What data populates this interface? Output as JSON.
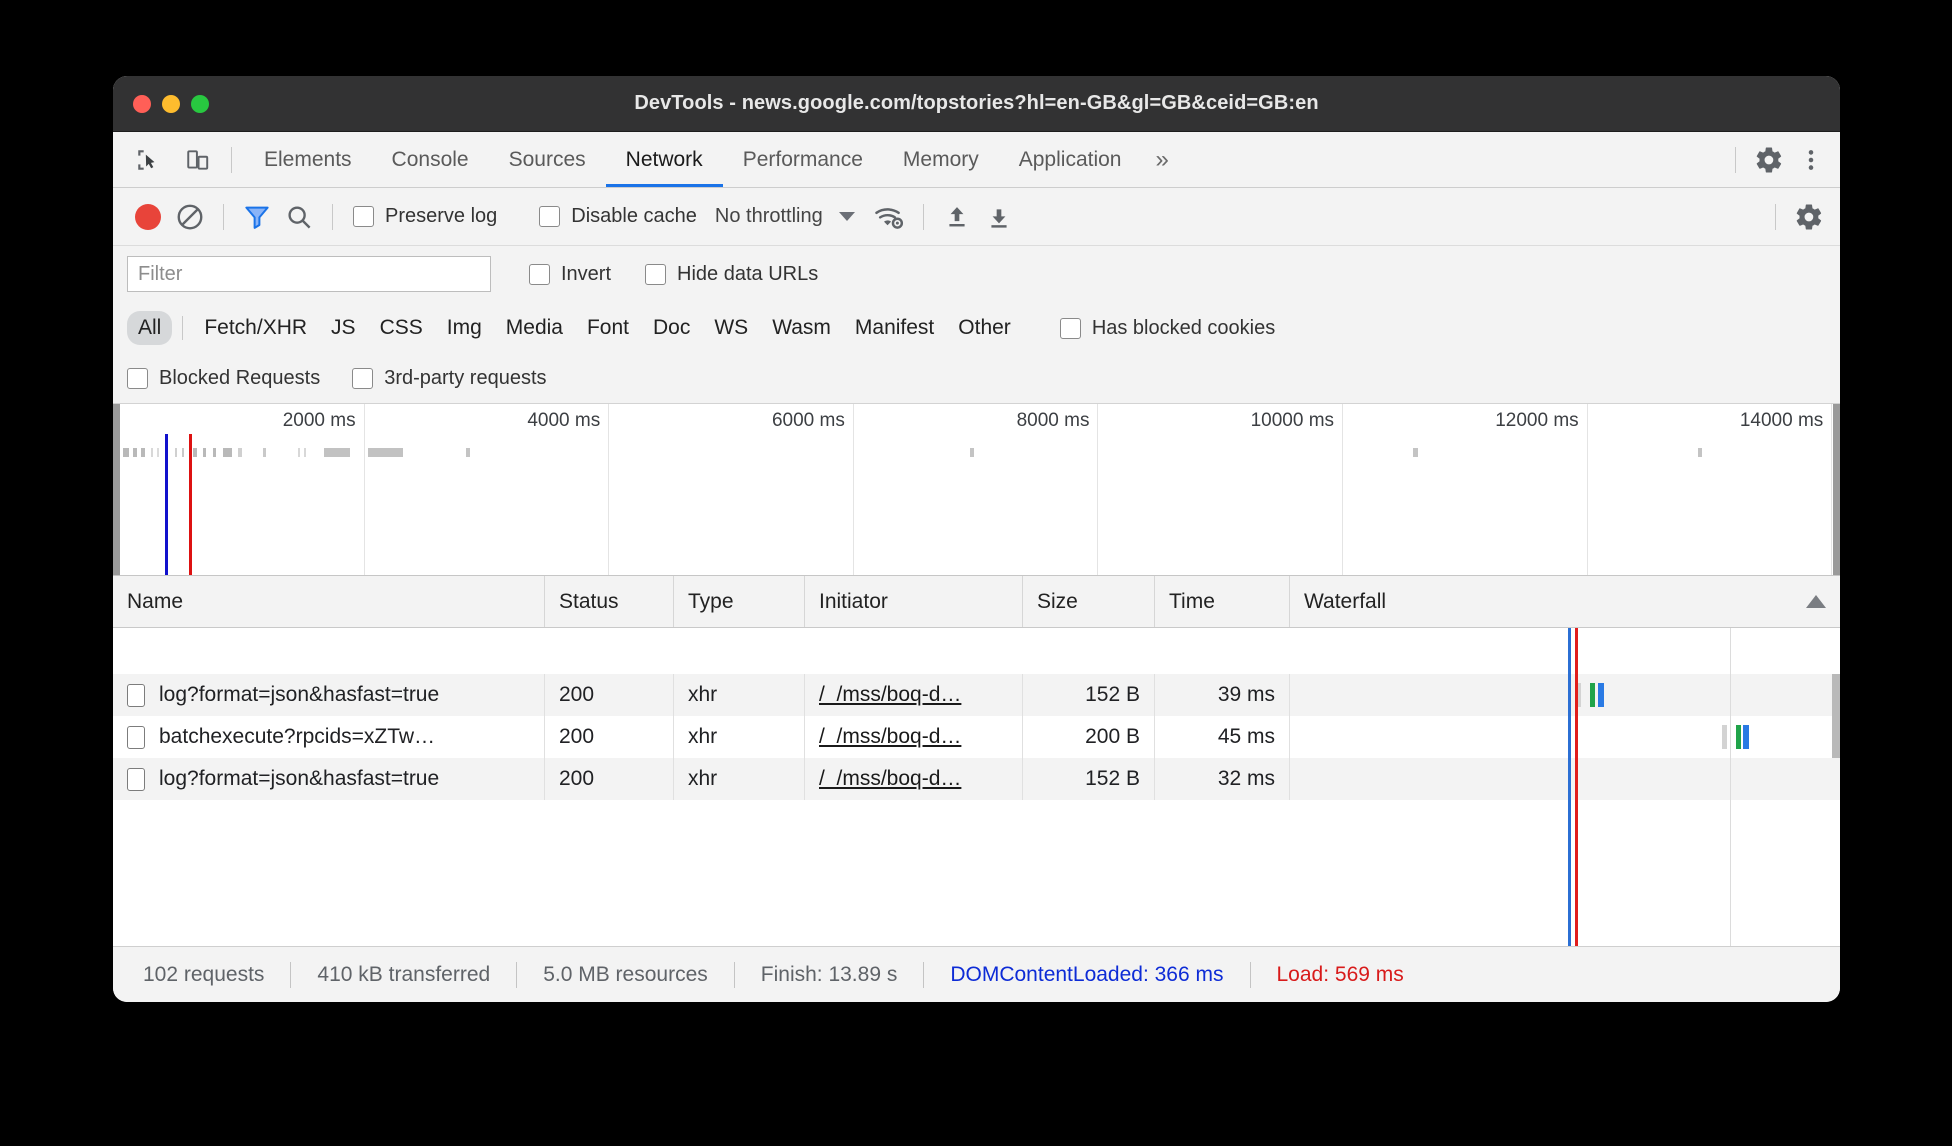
{
  "window": {
    "title": "DevTools - news.google.com/topstories?hl=en-GB&gl=GB&ceid=GB:en"
  },
  "tabstrip": {
    "tabs": [
      {
        "label": "Elements",
        "active": false
      },
      {
        "label": "Console",
        "active": false
      },
      {
        "label": "Sources",
        "active": false
      },
      {
        "label": "Network",
        "active": true
      },
      {
        "label": "Performance",
        "active": false
      },
      {
        "label": "Memory",
        "active": false
      },
      {
        "label": "Application",
        "active": false
      }
    ],
    "more_label": "»",
    "inspect_icon": "inspect-element-icon",
    "device_icon": "device-toolbar-icon",
    "settings_icon": "gear-icon",
    "menu_icon": "kebab-menu-icon"
  },
  "toolbar": {
    "record_icon": "record-icon",
    "clear_icon": "clear-icon",
    "filter_icon": "filter-funnel-icon",
    "search_icon": "search-icon",
    "preserve_log_label": "Preserve log",
    "preserve_log_checked": false,
    "disable_cache_label": "Disable cache",
    "disable_cache_checked": false,
    "throttling_value": "No throttling",
    "network_conditions_icon": "wifi-gear-icon",
    "import_har_icon": "upload-arrow-icon",
    "export_har_icon": "download-arrow-icon",
    "settings_icon": "gear-icon"
  },
  "filterbar": {
    "placeholder": "Filter",
    "value": "",
    "invert_label": "Invert",
    "invert_checked": false,
    "hide_data_urls_label": "Hide data URLs",
    "hide_data_urls_checked": false
  },
  "typefilters": {
    "chips": [
      {
        "label": "All",
        "active": true
      },
      {
        "label": "Fetch/XHR",
        "active": false
      },
      {
        "label": "JS",
        "active": false
      },
      {
        "label": "CSS",
        "active": false
      },
      {
        "label": "Img",
        "active": false
      },
      {
        "label": "Media",
        "active": false
      },
      {
        "label": "Font",
        "active": false
      },
      {
        "label": "Doc",
        "active": false
      },
      {
        "label": "WS",
        "active": false
      },
      {
        "label": "Wasm",
        "active": false
      },
      {
        "label": "Manifest",
        "active": false
      },
      {
        "label": "Other",
        "active": false
      }
    ],
    "has_blocked_cookies_label": "Has blocked cookies",
    "has_blocked_cookies_checked": false,
    "blocked_requests_label": "Blocked Requests",
    "blocked_requests_checked": false,
    "third_party_requests_label": "3rd-party requests",
    "third_party_requests_checked": false
  },
  "overview": {
    "ticks": [
      "2000 ms",
      "4000 ms",
      "6000 ms",
      "8000 ms",
      "10000 ms",
      "12000 ms",
      "14000 ms"
    ],
    "dcl_color": "#1111cc",
    "load_color": "#dd1111"
  },
  "table": {
    "columns": [
      {
        "label": "Name"
      },
      {
        "label": "Status"
      },
      {
        "label": "Type"
      },
      {
        "label": "Initiator"
      },
      {
        "label": "Size"
      },
      {
        "label": "Time"
      },
      {
        "label": "Waterfall"
      }
    ],
    "sort_indicator": "sort-ascending-icon",
    "rows": [
      {
        "name": "log?format=json&hasfast=true",
        "status": "200",
        "type": "xhr",
        "initiator": "/_/mss/boq-d…",
        "size": "152 B",
        "time": "39 ms"
      },
      {
        "name": "batchexecute?rpcids=xZTw…",
        "status": "200",
        "type": "xhr",
        "initiator": "/_/mss/boq-d…",
        "size": "200 B",
        "time": "45 ms"
      },
      {
        "name": "log?format=json&hasfast=true",
        "status": "200",
        "type": "xhr",
        "initiator": "/_/mss/boq-d…",
        "size": "152 B",
        "time": "32 ms"
      }
    ]
  },
  "footer": {
    "requests": "102 requests",
    "transferred": "410 kB transferred",
    "resources": "5.0 MB resources",
    "finish": "Finish: 13.89 s",
    "dom_content_loaded": "DOMContentLoaded: 366 ms",
    "load": "Load: 569 ms"
  }
}
